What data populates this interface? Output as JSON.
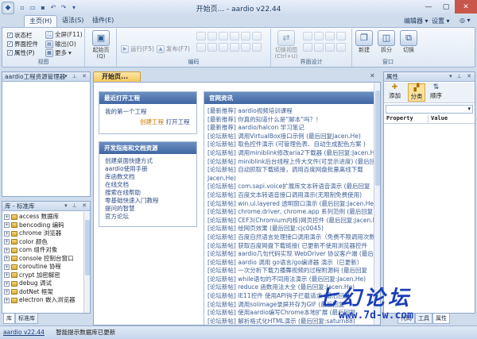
{
  "window": {
    "title": "开始页... - aardio v22.44",
    "help_label": "编辑器",
    "settings_label": "设置",
    "home_label": "主页(H)",
    "syntax_label": "语法(S)",
    "plugins_label": "插件(E)"
  },
  "ribbon": {
    "view_group": {
      "label": "视图",
      "checks": [
        {
          "label": "状态栏",
          "checked": true
        },
        {
          "label": "界面控件",
          "checked": true
        },
        {
          "label": "属性(P)",
          "checked": true
        }
      ],
      "fullscreen_label": "全屏(F11)",
      "output_label": "输出(O)",
      "more_label": "更多"
    },
    "start_page_label": "起始页(Q)",
    "code_group": {
      "label": "编码",
      "run_label": "运行(F5)",
      "publish_label": "发布(F7)"
    },
    "ui_group": {
      "label": "界面设计",
      "toggle_view_label": "切换视图\n(Ctrl+U)"
    },
    "window_group": {
      "label": "窗口",
      "new_label": "新建",
      "split_label": "拆分",
      "switch_label": "切换"
    }
  },
  "project_panel": {
    "title": "aardio工程资源管理器"
  },
  "library_panel": {
    "title": "库 - 标准库",
    "items": [
      "access 数据库",
      "bencoding 编码",
      "chrome 浏览器",
      "color 颜色",
      "com 组件对象",
      "console 控制台窗口",
      "coroutine 协程",
      "crypt 加密解密",
      "debug 调试",
      "dotNet 框架",
      "electron 嵌入浏览器"
    ],
    "bottom_tabs": [
      "库",
      "标准库"
    ]
  },
  "doc_tab": {
    "label": "开始页..."
  },
  "recent_card": {
    "title": "最近打开工程",
    "items": [
      "我的第一个工程"
    ],
    "create_label": "创建工程",
    "open_label": "打开工程"
  },
  "guide_card": {
    "title": "开发指南和文档资源",
    "links": [
      "创建桌面快捷方式",
      "aardio使用手册",
      "库函数文档",
      "在线文档",
      "搜索在线帮助",
      "零基础快速入门教程",
      "提问的智慧",
      "官方论坛"
    ]
  },
  "news_card": {
    "title": "官网资讯",
    "items": [
      "[最新推荐] aardio视频培训课程",
      "[最新推荐] 你真的知道什么是“脚本”吗？！",
      "[最新推荐] aardio/halcon 学习笔记",
      "[论坛新帖] 调用VirtualBox接口示例 (最后回复Jacen.He)",
      "[论坛新帖] 取色控件演示 (可管理色表、自动生成配色方案 )",
      "[论坛新帖] 调用miniblink修改aria2下载器 (最后回复:Jacen.He)",
      "[论坛新帖] miniblink后台线程上传大文件(可显示进度) (最后回复",
      "[论坛新帖] 自动抓取下载链接，调用百度网盘批量离线下载",
      "Jacen.He)",
      "[论坛新帖] com.sapi.voice扩展库文本转语音演示 (最后回复",
      "[论坛新帖] 百度文本转语音接口调用演示(无限制免费使用)",
      "[论坛新帖] win.ui.layered 透明窗口演示 (最后回复:Jacen.He)",
      "[论坛新帖] chrome.driver, chrome.app 系列范例 (最后回复",
      "[论坛新帖] CEF3(Chromium内核)网页控件 (最后回复:Jacen.He",
      "[论坛新帖] 绘网页效果 (最后回复:cjc0045)",
      "[论坛新帖] 百度自然语言处理接口调用演示（免费不限调用次数",
      "[论坛新帖] 获取百度网盘下载链接( 已更新不使用浏览器控件",
      "[论坛新帖] aardio几句代码实现 WebDriver 协议客户端 (最后回复",
      "[论坛新帖] aardio 调用 go语言/go编译器 演示（已更新）",
      "[论坛新帖] 一次分析下载力播舞视频的过程附源码 (最后回复",
      "[论坛新帖] while语句的不同用法演示 (最后回复:Jacen.He)",
      "[论坛新帖] reduce 函数用法大全 (最后回复:Jacen.He)",
      "[论坛新帖] IE11控件 使用API钩子拦截请求 (最后回复",
      "[论坛新帖] 调用solimage录屏并存为GIF (最后回复",
      "[论坛新帖] 使用aardio编写Chrome本地扩展 (最后回复",
      "[论坛新帖] 解析格式化HTML演示 (最后回复:saturn88)"
    ]
  },
  "props_panel": {
    "title": "属性",
    "add_label": "添加",
    "category_label": "分类",
    "order_label": "顺序",
    "col_property": "Property",
    "col_value": "Value",
    "bottom_tabs": [
      "代码",
      "工具",
      "属性"
    ]
  },
  "status": {
    "version": "aardio v22.44",
    "message": "智能提示数据库已更新"
  },
  "watermark": {
    "logo_text": "七幻论坛",
    "url": "www.7d-w.com"
  }
}
